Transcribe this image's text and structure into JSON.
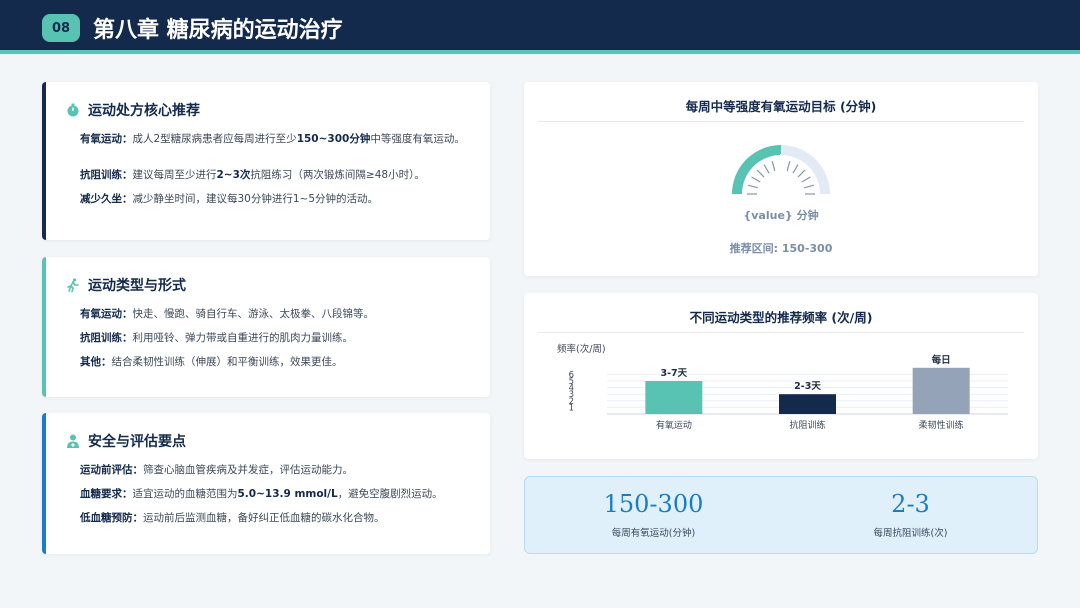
{
  "header": {
    "chapter_num": "08",
    "title": "第八章 糖尿病的运动治疗"
  },
  "sections": [
    {
      "title": "运动处方核心推荐",
      "icon": "stopwatch-icon",
      "lines": [
        {
          "label": "有氧运动：",
          "pre": "成人2型糖尿病患者应每周进行至少",
          "hl": "150~300分钟",
          "post": "中等强度有氧运动。"
        },
        {
          "label": "抗阻训练：",
          "pre": "建议每周至少进行",
          "hl": "2~3次",
          "post": "抗阻练习（两次锻炼间隔≥48小时）。"
        },
        {
          "label": "减少久坐：",
          "pre": "减少静坐时间，建议每30分钟进行1~5分钟的活动。",
          "hl": "",
          "post": ""
        }
      ]
    },
    {
      "title": "运动类型与形式",
      "icon": "running-icon",
      "lines": [
        {
          "label": "有氧运动：",
          "pre": "快走、慢跑、骑自行车、游泳、太极拳、八段锦等。",
          "hl": "",
          "post": ""
        },
        {
          "label": "抗阻训练：",
          "pre": "利用哑铃、弹力带或自重进行的肌肉力量训练。",
          "hl": "",
          "post": ""
        },
        {
          "label": "其他：",
          "pre": "结合柔韧性训练（伸展）和平衡训练，效果更佳。",
          "hl": "",
          "post": ""
        }
      ]
    },
    {
      "title": "安全与评估要点",
      "icon": "doctor-icon",
      "lines": [
        {
          "label": "运动前评估：",
          "pre": "筛查心脑血管疾病及并发症，评估运动能力。",
          "hl": "",
          "post": ""
        },
        {
          "label": "血糖要求：",
          "pre": "适宜运动的血糖范围为",
          "hl": "5.0~13.9 mmol/L",
          "post": "，避免空腹剧烈运动。"
        },
        {
          "label": "低血糖预防：",
          "pre": "运动前后监测血糖，备好纠正低血糖的碳水化合物。",
          "hl": "",
          "post": ""
        }
      ]
    }
  ],
  "gauge": {
    "title": "每周中等强度有氧运动目标 (分钟)",
    "value_text": "{value} 分钟",
    "range_text": "推荐区间: 150-300",
    "fill_fraction": 0.5
  },
  "chart_data": {
    "type": "bar",
    "title": "不同运动类型的推荐频率 (次/周)",
    "ylabel": "频率(次/周)",
    "categories": [
      "有氧运动",
      "抗阻训练",
      "柔韧性训练"
    ],
    "values": [
      5,
      3,
      7
    ],
    "data_labels": [
      "3-7天",
      "2-3天",
      "每日"
    ],
    "colors": [
      "#59c3b3",
      "#142a4c",
      "#94a3b8"
    ],
    "yticks": [
      "1",
      "2",
      "3",
      "4",
      "5",
      "6"
    ],
    "ylim": [
      0,
      7
    ]
  },
  "stats": [
    {
      "value": "150-300",
      "label": "每周有氧运动(分钟)"
    },
    {
      "value": "2-3",
      "label": "每周抗阻训练(次)"
    }
  ],
  "colors": {
    "navy": "#142a4c",
    "teal": "#59c3b3",
    "blue": "#1a7dc4"
  }
}
